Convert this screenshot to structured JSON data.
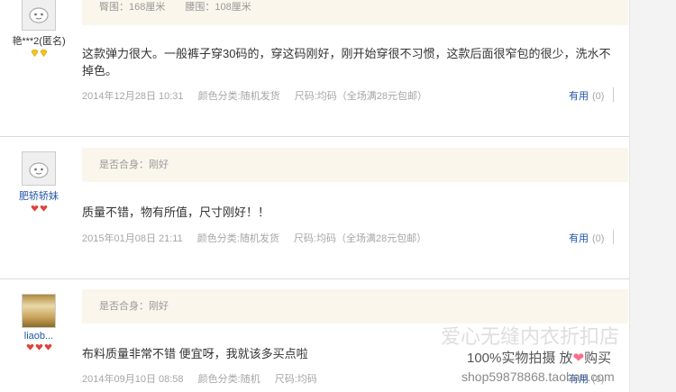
{
  "reviews": [
    {
      "user": {
        "name": "艳***2(匿名)"
      },
      "meta": "臀围：168厘米　　腰围：108厘米",
      "content": "这款弹力很大。一般裤子穿30码的，穿这码刚好，刚开始穿很不习惯，这款后面很窄包的很少，洗水不掉色。",
      "date": "2014年12月28日 10:31",
      "color": "颜色分类:随机发货",
      "size": "尺码:均码（全场满28元包邮）",
      "useful_label": "有用",
      "useful_count": "(0)"
    },
    {
      "user": {
        "name": "肥轿轿妹"
      },
      "meta": "是否合身：刚好",
      "content": "质量不错，物有所值，尺寸刚好！！",
      "date": "2015年01月08日 21:11",
      "color": "颜色分类:随机发货",
      "size": "尺码:均码（全场满28元包邮）",
      "useful_label": "有用",
      "useful_count": "(0)"
    },
    {
      "user": {
        "name": "liaob..."
      },
      "meta": "是否合身：刚好",
      "content": "布料质量非常不错 便宜呀，我就该多买点啦",
      "date": "2014年09月10日 08:58",
      "color": "颜色分类:随机",
      "size": "尺码:均码",
      "useful_label": "有用",
      "useful_count": "(0)"
    }
  ],
  "watermark": {
    "shop_name": "爱心无缝内衣折扣店",
    "slogan_left": "100%实物拍摄  放",
    "slogan_heart": "❤",
    "slogan_right": "购买",
    "url": "shop59878868.taobao.com"
  },
  "colors": {
    "link": "#2255aa",
    "meta_bg": "#fbf6ec",
    "gem_yellow": "#f5c518",
    "gem_red": "#e0443a"
  }
}
